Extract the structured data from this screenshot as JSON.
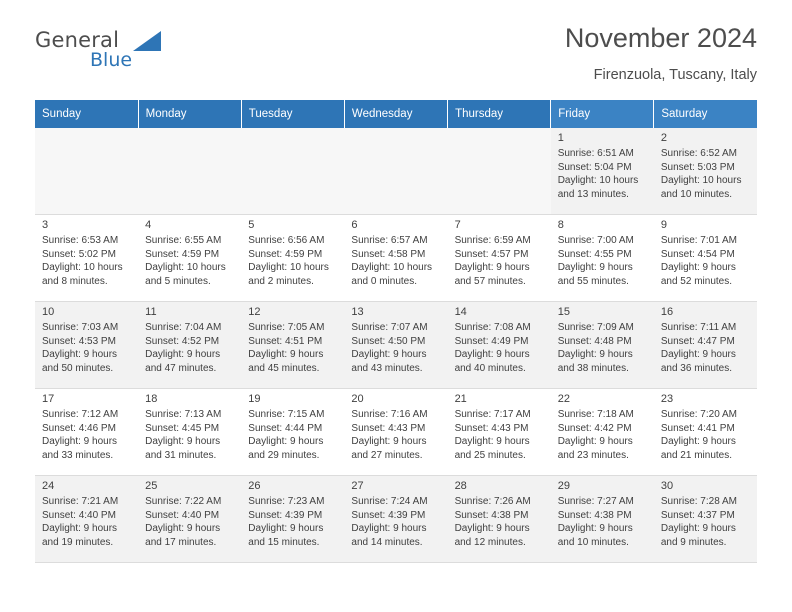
{
  "brand": {
    "general": "General",
    "blue": "Blue",
    "flag_icon": "blue-flag-icon"
  },
  "header": {
    "title": "November 2024",
    "location": "Firenzuola, Tuscany, Italy"
  },
  "calendar": {
    "weekdays": [
      "Sunday",
      "Monday",
      "Tuesday",
      "Wednesday",
      "Thursday",
      "Friday",
      "Saturday"
    ],
    "weeks": [
      [
        {
          "day": "",
          "info": ""
        },
        {
          "day": "",
          "info": ""
        },
        {
          "day": "",
          "info": ""
        },
        {
          "day": "",
          "info": ""
        },
        {
          "day": "",
          "info": ""
        },
        {
          "day": "1",
          "info": "Sunrise: 6:51 AM\nSunset: 5:04 PM\nDaylight: 10 hours\nand 13 minutes."
        },
        {
          "day": "2",
          "info": "Sunrise: 6:52 AM\nSunset: 5:03 PM\nDaylight: 10 hours\nand 10 minutes."
        }
      ],
      [
        {
          "day": "3",
          "info": "Sunrise: 6:53 AM\nSunset: 5:02 PM\nDaylight: 10 hours\nand 8 minutes."
        },
        {
          "day": "4",
          "info": "Sunrise: 6:55 AM\nSunset: 4:59 PM\nDaylight: 10 hours\nand 5 minutes."
        },
        {
          "day": "5",
          "info": "Sunrise: 6:56 AM\nSunset: 4:59 PM\nDaylight: 10 hours\nand 2 minutes."
        },
        {
          "day": "6",
          "info": "Sunrise: 6:57 AM\nSunset: 4:58 PM\nDaylight: 10 hours\nand 0 minutes."
        },
        {
          "day": "7",
          "info": "Sunrise: 6:59 AM\nSunset: 4:57 PM\nDaylight: 9 hours\nand 57 minutes."
        },
        {
          "day": "8",
          "info": "Sunrise: 7:00 AM\nSunset: 4:55 PM\nDaylight: 9 hours\nand 55 minutes."
        },
        {
          "day": "9",
          "info": "Sunrise: 7:01 AM\nSunset: 4:54 PM\nDaylight: 9 hours\nand 52 minutes."
        }
      ],
      [
        {
          "day": "10",
          "info": "Sunrise: 7:03 AM\nSunset: 4:53 PM\nDaylight: 9 hours\nand 50 minutes."
        },
        {
          "day": "11",
          "info": "Sunrise: 7:04 AM\nSunset: 4:52 PM\nDaylight: 9 hours\nand 47 minutes."
        },
        {
          "day": "12",
          "info": "Sunrise: 7:05 AM\nSunset: 4:51 PM\nDaylight: 9 hours\nand 45 minutes."
        },
        {
          "day": "13",
          "info": "Sunrise: 7:07 AM\nSunset: 4:50 PM\nDaylight: 9 hours\nand 43 minutes."
        },
        {
          "day": "14",
          "info": "Sunrise: 7:08 AM\nSunset: 4:49 PM\nDaylight: 9 hours\nand 40 minutes."
        },
        {
          "day": "15",
          "info": "Sunrise: 7:09 AM\nSunset: 4:48 PM\nDaylight: 9 hours\nand 38 minutes."
        },
        {
          "day": "16",
          "info": "Sunrise: 7:11 AM\nSunset: 4:47 PM\nDaylight: 9 hours\nand 36 minutes."
        }
      ],
      [
        {
          "day": "17",
          "info": "Sunrise: 7:12 AM\nSunset: 4:46 PM\nDaylight: 9 hours\nand 33 minutes."
        },
        {
          "day": "18",
          "info": "Sunrise: 7:13 AM\nSunset: 4:45 PM\nDaylight: 9 hours\nand 31 minutes."
        },
        {
          "day": "19",
          "info": "Sunrise: 7:15 AM\nSunset: 4:44 PM\nDaylight: 9 hours\nand 29 minutes."
        },
        {
          "day": "20",
          "info": "Sunrise: 7:16 AM\nSunset: 4:43 PM\nDaylight: 9 hours\nand 27 minutes."
        },
        {
          "day": "21",
          "info": "Sunrise: 7:17 AM\nSunset: 4:43 PM\nDaylight: 9 hours\nand 25 minutes."
        },
        {
          "day": "22",
          "info": "Sunrise: 7:18 AM\nSunset: 4:42 PM\nDaylight: 9 hours\nand 23 minutes."
        },
        {
          "day": "23",
          "info": "Sunrise: 7:20 AM\nSunset: 4:41 PM\nDaylight: 9 hours\nand 21 minutes."
        }
      ],
      [
        {
          "day": "24",
          "info": "Sunrise: 7:21 AM\nSunset: 4:40 PM\nDaylight: 9 hours\nand 19 minutes."
        },
        {
          "day": "25",
          "info": "Sunrise: 7:22 AM\nSunset: 4:40 PM\nDaylight: 9 hours\nand 17 minutes."
        },
        {
          "day": "26",
          "info": "Sunrise: 7:23 AM\nSunset: 4:39 PM\nDaylight: 9 hours\nand 15 minutes."
        },
        {
          "day": "27",
          "info": "Sunrise: 7:24 AM\nSunset: 4:39 PM\nDaylight: 9 hours\nand 14 minutes."
        },
        {
          "day": "28",
          "info": "Sunrise: 7:26 AM\nSunset: 4:38 PM\nDaylight: 9 hours\nand 12 minutes."
        },
        {
          "day": "29",
          "info": "Sunrise: 7:27 AM\nSunset: 4:38 PM\nDaylight: 9 hours\nand 10 minutes."
        },
        {
          "day": "30",
          "info": "Sunrise: 7:28 AM\nSunset: 4:37 PM\nDaylight: 9 hours\nand 9 minutes."
        }
      ]
    ]
  },
  "colors": {
    "header_blue": "#2e75b6",
    "row_shade": "#f2f2f2",
    "text": "#404040"
  }
}
